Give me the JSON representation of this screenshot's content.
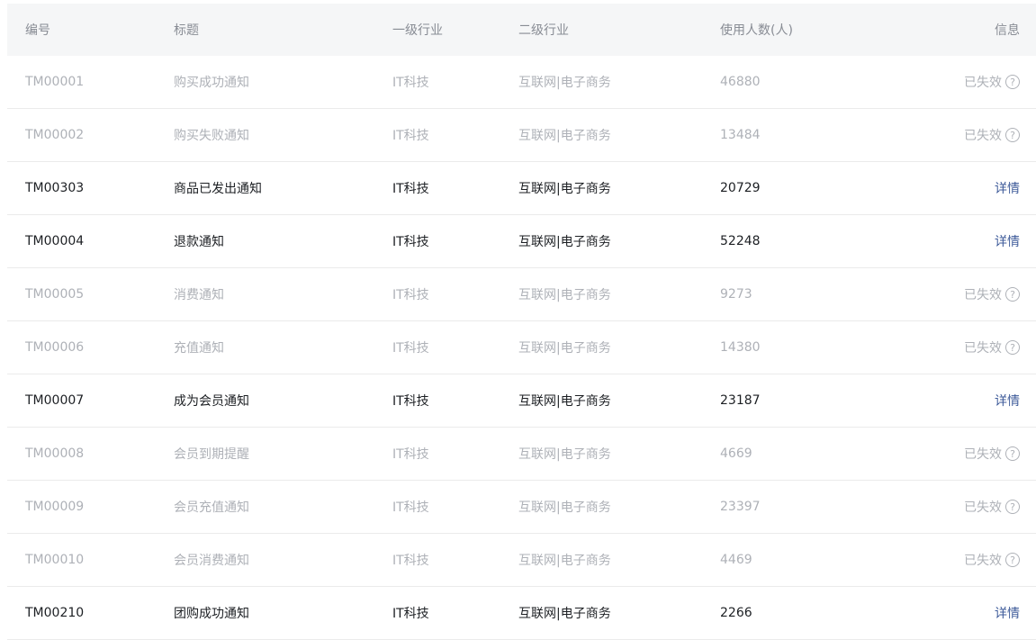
{
  "columns": {
    "id": "编号",
    "title": "标题",
    "industry1": "一级行业",
    "industry2": "二级行业",
    "users": "使用人数(人)",
    "info": "信息"
  },
  "rows": [
    {
      "id": "TM00001",
      "title": "购买成功通知",
      "industry1": "IT科技",
      "industry2": "互联网|电子商务",
      "users": "46880",
      "info": "已失效",
      "status": "expired"
    },
    {
      "id": "TM00002",
      "title": "购买失败通知",
      "industry1": "IT科技",
      "industry2": "互联网|电子商务",
      "users": "13484",
      "info": "已失效",
      "status": "expired"
    },
    {
      "id": "TM00303",
      "title": "商品已发出通知",
      "industry1": "IT科技",
      "industry2": "互联网|电子商务",
      "users": "20729",
      "info": "详情",
      "status": "active"
    },
    {
      "id": "TM00004",
      "title": "退款通知",
      "industry1": "IT科技",
      "industry2": "互联网|电子商务",
      "users": "52248",
      "info": "详情",
      "status": "active"
    },
    {
      "id": "TM00005",
      "title": "消费通知",
      "industry1": "IT科技",
      "industry2": "互联网|电子商务",
      "users": "9273",
      "info": "已失效",
      "status": "expired"
    },
    {
      "id": "TM00006",
      "title": "充值通知",
      "industry1": "IT科技",
      "industry2": "互联网|电子商务",
      "users": "14380",
      "info": "已失效",
      "status": "expired"
    },
    {
      "id": "TM00007",
      "title": "成为会员通知",
      "industry1": "IT科技",
      "industry2": "互联网|电子商务",
      "users": "23187",
      "info": "详情",
      "status": "active"
    },
    {
      "id": "TM00008",
      "title": "会员到期提醒",
      "industry1": "IT科技",
      "industry2": "互联网|电子商务",
      "users": "4669",
      "info": "已失效",
      "status": "expired"
    },
    {
      "id": "TM00009",
      "title": "会员充值通知",
      "industry1": "IT科技",
      "industry2": "互联网|电子商务",
      "users": "23397",
      "info": "已失效",
      "status": "expired"
    },
    {
      "id": "TM00010",
      "title": "会员消费通知",
      "industry1": "IT科技",
      "industry2": "互联网|电子商务",
      "users": "4469",
      "info": "已失效",
      "status": "expired"
    },
    {
      "id": "TM00210",
      "title": "团购成功通知",
      "industry1": "IT科技",
      "industry2": "互联网|电子商务",
      "users": "2266",
      "info": "详情",
      "status": "active"
    }
  ],
  "icons": {
    "help": "question-circle-icon"
  },
  "colors": {
    "header_bg": "#f5f6f7",
    "expired_text": "#aeb1b7",
    "active_text": "#1c1f23",
    "link": "#3d5a99"
  }
}
